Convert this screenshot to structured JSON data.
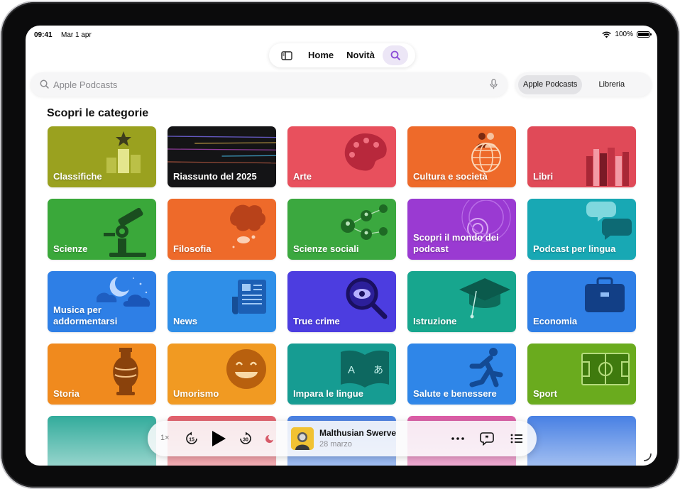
{
  "status_bar": {
    "time": "09:41",
    "date": "Mar 1 apr",
    "battery": "100%"
  },
  "tab_bar": {
    "tabs": [
      "Home",
      "Novità"
    ]
  },
  "search": {
    "placeholder": "Apple Podcasts"
  },
  "scope": {
    "options": [
      "Apple Podcasts",
      "Libreria"
    ],
    "selected": "Apple Podcasts"
  },
  "section_title": "Scopri le categorie",
  "categories": [
    {
      "label": "Classifiche",
      "color": "#9aa11f",
      "icon": "podium-star-icon"
    },
    {
      "label": "Riassunto del 2025",
      "color": "#141416",
      "icon": "light-streaks-icon"
    },
    {
      "label": "Arte",
      "color": "#e8505d",
      "icon": "palette-icon"
    },
    {
      "label": "Cultura e società",
      "color": "#ee6a2a",
      "icon": "globe-people-icon"
    },
    {
      "label": "Libri",
      "color": "#e04a58",
      "icon": "books-icon"
    },
    {
      "label": "Scienze",
      "color": "#3aa83a",
      "icon": "microscope-icon"
    },
    {
      "label": "Filosofia",
      "color": "#ee6a2a",
      "icon": "thought-bubble-icon"
    },
    {
      "label": "Scienze sociali",
      "color": "#3ba83f",
      "icon": "network-people-icon"
    },
    {
      "label": "Scopri il mondo dei podcast",
      "color": "#9a3ad2",
      "icon": "podcast-rings-icon"
    },
    {
      "label": "Podcast per lingua",
      "color": "#18a8b4",
      "icon": "speech-bubbles-icon"
    },
    {
      "label": "Musica per addormentarsi",
      "color": "#2e7fe6",
      "icon": "moon-clouds-icon"
    },
    {
      "label": "News",
      "color": "#2f8fe8",
      "icon": "newspaper-icon"
    },
    {
      "label": "True crime",
      "color": "#4c3de0",
      "icon": "magnifier-eye-icon"
    },
    {
      "label": "Istruzione",
      "color": "#17a68e",
      "icon": "graduation-cap-icon"
    },
    {
      "label": "Economia",
      "color": "#2f7fe6",
      "icon": "briefcase-icon"
    },
    {
      "label": "Storia",
      "color": "#f08a1e",
      "icon": "amphora-icon"
    },
    {
      "label": "Umorismo",
      "color": "#f19a22",
      "icon": "laughing-face-icon"
    },
    {
      "label": "Impara le lingue",
      "color": "#169c92",
      "icon": "bilingual-book-icon"
    },
    {
      "label": "Salute e benessere",
      "color": "#2f86e8",
      "icon": "runner-icon"
    },
    {
      "label": "Sport",
      "color": "#6aab1e",
      "icon": "soccer-field-icon"
    }
  ],
  "partial_row_colors": [
    "#16a08e",
    "#e04a58",
    "#2f6fe0",
    "#d8459a",
    "#2f6fe0"
  ],
  "player": {
    "rate": "1×",
    "skip_back": "15",
    "skip_forward": "30",
    "title": "Malthusian Swerve",
    "date": "28 marzo"
  }
}
